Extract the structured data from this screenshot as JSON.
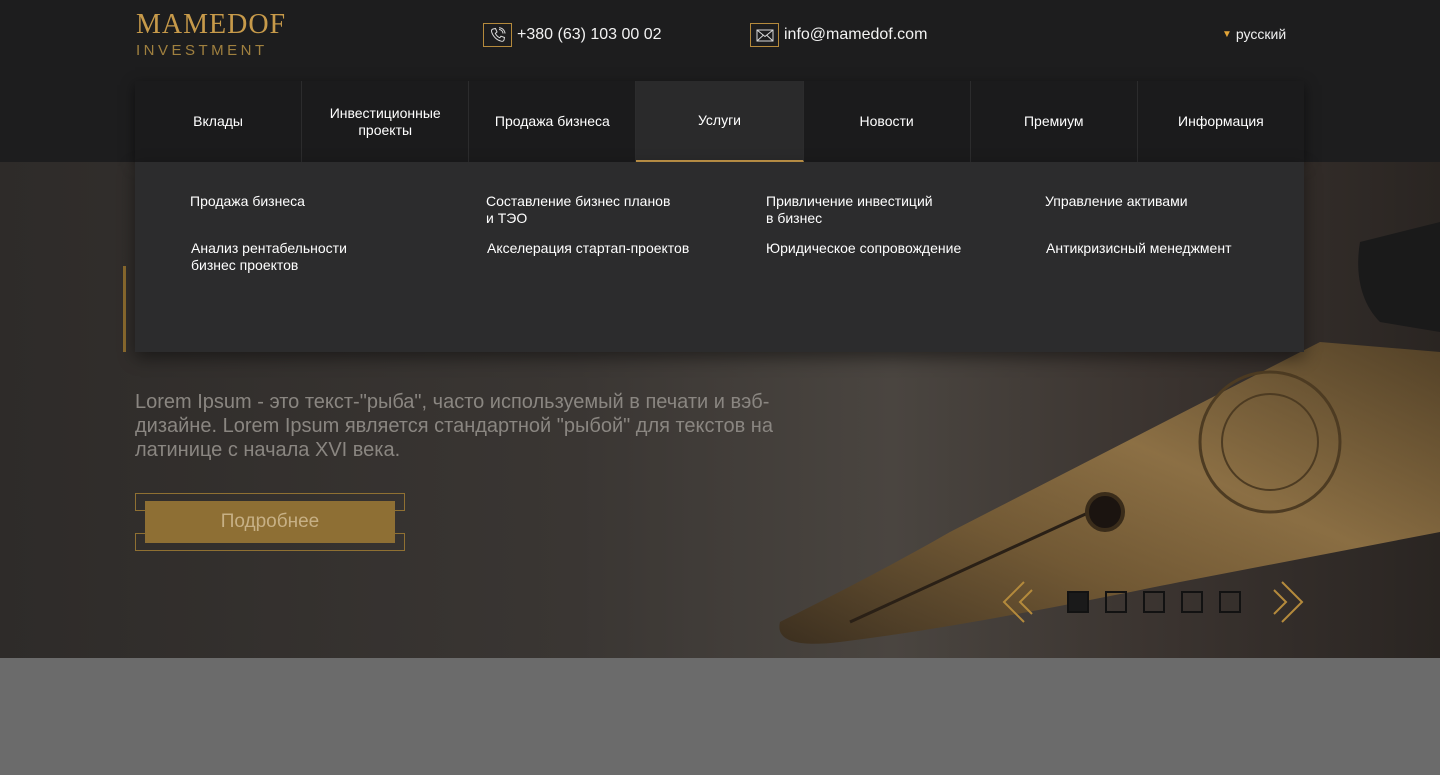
{
  "brand": {
    "name": "MAMEDOF",
    "tagline": "INVESTMENT"
  },
  "contacts": {
    "phone": "+380 (63) 103 00 02",
    "email": "info@mamedof.com"
  },
  "language": {
    "current": "русский"
  },
  "nav": {
    "items": [
      {
        "label": "Вклады"
      },
      {
        "label": "Инвестиционные\nпроекты"
      },
      {
        "label": "Продажа бизнеса"
      },
      {
        "label": "Услуги",
        "active": true
      },
      {
        "label": "Новости"
      },
      {
        "label": "Премиум"
      },
      {
        "label": "Информация"
      }
    ]
  },
  "dropdown": {
    "items": [
      {
        "label": "Продажа бизнеса"
      },
      {
        "label": "Составление бизнес планов\nи ТЭО"
      },
      {
        "label": "Привличение инвестиций\nв бизнес"
      },
      {
        "label": "Управление активами"
      },
      {
        "label": "Анализ рентабельности\nбизнес проектов"
      },
      {
        "label": "Акселерация стартап-проектов"
      },
      {
        "label": "Юридическое сопровождение"
      },
      {
        "label": "Антикризисный менеджмент"
      }
    ]
  },
  "hero": {
    "text": "Lorem Ipsum - это текст-\"рыба\", часто используемый в печати и вэб-дизайне. Lorem Ipsum является стандартной \"рыбой\" для текстов на латинице с начала XVI века.",
    "button_label": "Подробнее"
  },
  "slider": {
    "slide_count": 5,
    "active_index": 0
  },
  "colors": {
    "accent": "#c79a4a",
    "header_bg": "#1d1d1e",
    "dropdown_bg": "#2c2c2d"
  }
}
